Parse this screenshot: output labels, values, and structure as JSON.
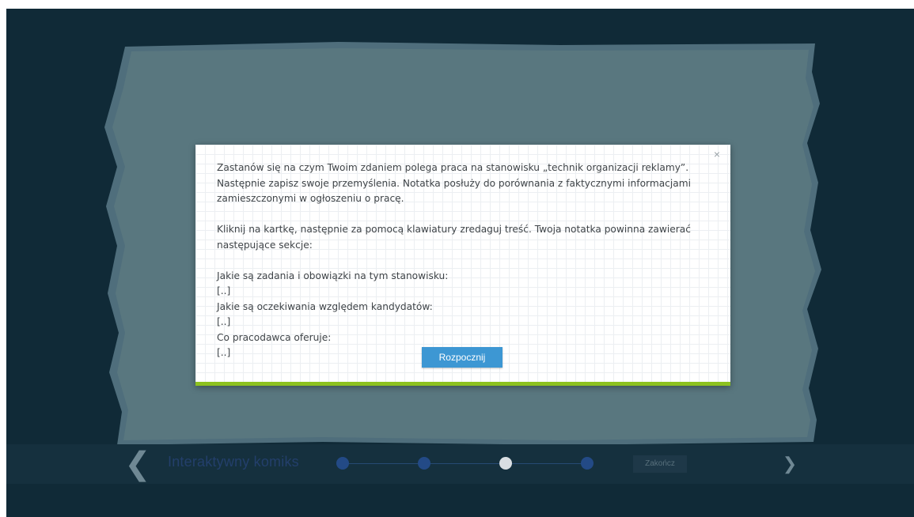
{
  "nav": {
    "prev_icon": "chevron-left-icon",
    "title": "Interaktywny komiks",
    "finish_label": "Zakończ",
    "next_icon": "chevron-right-icon",
    "steps_total": 4,
    "current_step": 3
  },
  "modal": {
    "close_icon": "close-icon",
    "close_glyph": "×",
    "intro_lines": [
      "Zastanów się na czym Twoim zdaniem polega praca na stanowisku „technik organizacji reklamy”.",
      "Następnie zapisz swoje przemyślenia. Notatka posłuży do porównania z faktycznymi informacjami",
      "zamieszczonymi w ogłoszeniu o pracę."
    ],
    "instruction_lines": [
      "Kliknij na kartkę, następnie za pomocą klawiatury zredaguj treść. Twoja notatka powinna zawierać",
      "następujące sekcje:"
    ],
    "sections": [
      {
        "label": "Jakie są zadania i obowiązki na tym stanowisku:",
        "placeholder": "[..]"
      },
      {
        "label": "Jakie są oczekiwania względem kandydatów:",
        "placeholder": "[..]"
      },
      {
        "label": "Co pracodawca oferuje:",
        "placeholder": "[..]"
      }
    ],
    "start_label": "Rozpocznij",
    "accent_color": "#8dc21f",
    "button_color": "#3d97d3"
  }
}
